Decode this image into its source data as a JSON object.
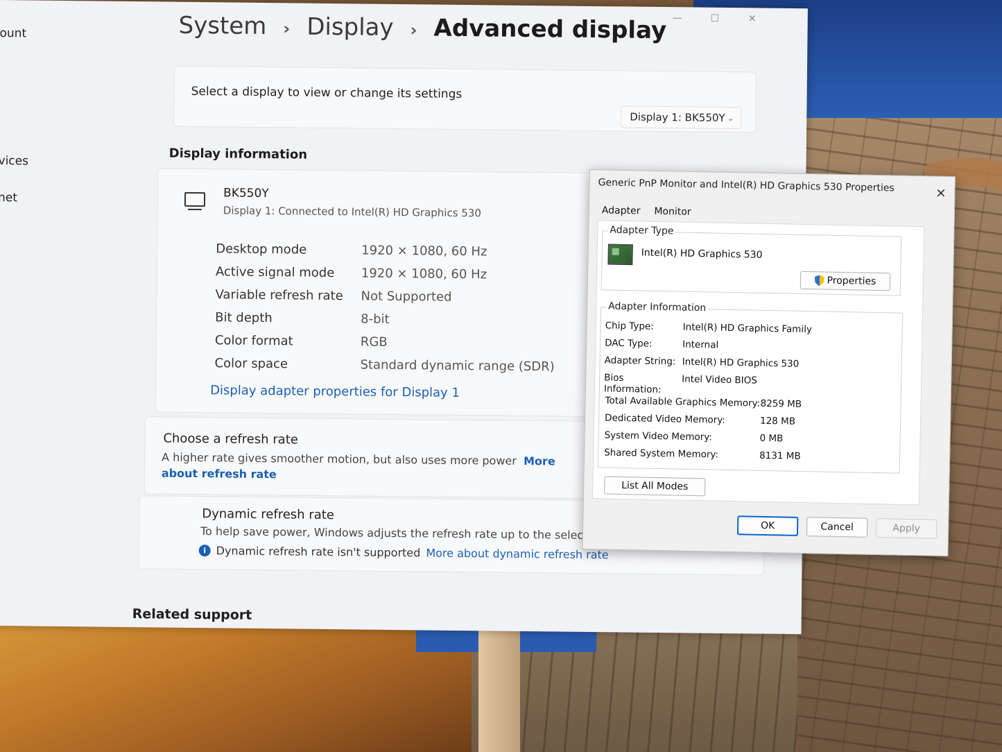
{
  "nav": {
    "item_account": "ount",
    "item_devices": "vices",
    "item_network": "net"
  },
  "breadcrumb": {
    "root": "System",
    "parent": "Display",
    "current": "Advanced display",
    "separator": "›"
  },
  "select_display": {
    "label": "Select a display to view or change its settings",
    "selected": "Display 1: BK550Y"
  },
  "display_info": {
    "section_title": "Display information",
    "name": "BK550Y",
    "subtitle": "Display 1: Connected to Intel(R) HD Graphics 530",
    "rows": [
      {
        "label": "Desktop mode",
        "value": "1920 × 1080, 60 Hz"
      },
      {
        "label": "Active signal mode",
        "value": "1920 × 1080, 60 Hz"
      },
      {
        "label": "Variable refresh rate",
        "value": "Not Supported"
      },
      {
        "label": "Bit depth",
        "value": "8-bit"
      },
      {
        "label": "Color format",
        "value": "RGB"
      },
      {
        "label": "Color space",
        "value": "Standard dynamic range (SDR)"
      }
    ],
    "adapter_link": "Display adapter properties for Display 1"
  },
  "refresh_rate": {
    "title": "Choose a refresh rate",
    "description": "A higher rate gives smoother motion, but also uses more power",
    "link": "More about refresh rate"
  },
  "dynamic_refresh": {
    "title": "Dynamic refresh rate",
    "description": "To help save power, Windows adjusts the refresh rate up to the selected r",
    "warning": "Dynamic refresh rate isn't supported",
    "link": "More about dynamic refresh rate"
  },
  "related_support": "Related support",
  "dialog": {
    "title": "Generic PnP Monitor and Intel(R) HD Graphics 530 Properties",
    "tabs": [
      "Adapter",
      "Monitor"
    ],
    "adapter_type": {
      "label": "Adapter Type",
      "value": "Intel(R) HD Graphics 530",
      "properties_button": "Properties"
    },
    "adapter_information": {
      "label": "Adapter Information",
      "rows": [
        {
          "label": "Chip Type:",
          "value": "Intel(R) HD Graphics Family"
        },
        {
          "label": "DAC Type:",
          "value": "Internal"
        },
        {
          "label": "Adapter String:",
          "value": "Intel(R) HD Graphics 530"
        },
        {
          "label": "Bios Information:",
          "value": "Intel Video BIOS"
        }
      ],
      "memory": [
        {
          "label": "Total Available Graphics Memory:",
          "value": "8259 MB"
        },
        {
          "label": "Dedicated Video Memory:",
          "value": "128 MB"
        },
        {
          "label": "System Video Memory:",
          "value": "0 MB"
        },
        {
          "label": "Shared System Memory:",
          "value": "8131 MB"
        }
      ]
    },
    "list_all_modes": "List All Modes",
    "ok": "OK",
    "cancel": "Cancel",
    "apply": "Apply"
  }
}
